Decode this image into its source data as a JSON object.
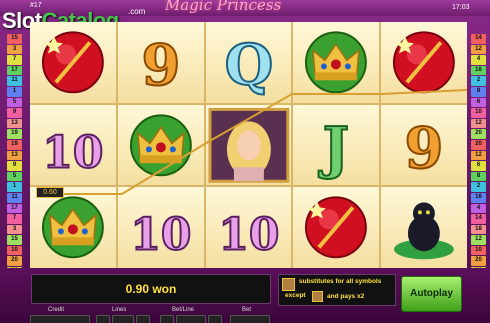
{
  "header": {
    "title": "Magic Princess",
    "game_id": "#17",
    "clock": "17:03",
    "logo_slot": "Slot",
    "logo_catalog": "Catalog",
    "logo_com": ".com"
  },
  "lines": {
    "left": [
      "15",
      "3",
      "7",
      "17",
      "11",
      "1",
      "5",
      "9",
      "13",
      "19",
      "19",
      "13",
      "9",
      "5",
      "1",
      "11",
      "17",
      "7",
      "3",
      "15",
      "10",
      "20",
      "16",
      "2",
      "8",
      "6",
      "4",
      "18"
    ],
    "right": [
      "14",
      "12",
      "4",
      "16",
      "2",
      "8",
      "6",
      "10",
      "12",
      "20",
      "20",
      "12",
      "6",
      "8",
      "2",
      "16",
      "4",
      "14",
      "18",
      "12",
      "10",
      "20",
      "16",
      "2",
      "18",
      "6",
      "4",
      "18"
    ]
  },
  "reels": [
    [
      "wand",
      "10",
      "crown"
    ],
    [
      "9",
      "crown",
      "10"
    ],
    [
      "Q",
      "princess",
      "10"
    ],
    [
      "crown",
      "J",
      "wand"
    ],
    [
      "wand",
      "9",
      "panther"
    ]
  ],
  "win_badge": "0.60",
  "win_text": "0.90 won",
  "info": {
    "line1": "substitutes for all symbols",
    "line2": "except",
    "line3": "and pays x2"
  },
  "autoplay_label": "Autoplay",
  "bottom_labels": {
    "credit": "Credit",
    "lines": "Lines",
    "betline": "Bet/Line",
    "bet": "Bet"
  },
  "colors": {
    "frame": "#6b1a6b",
    "win_text": "#ffe040",
    "autoplay": "#5ec82a",
    "payline": "#d8a030"
  }
}
